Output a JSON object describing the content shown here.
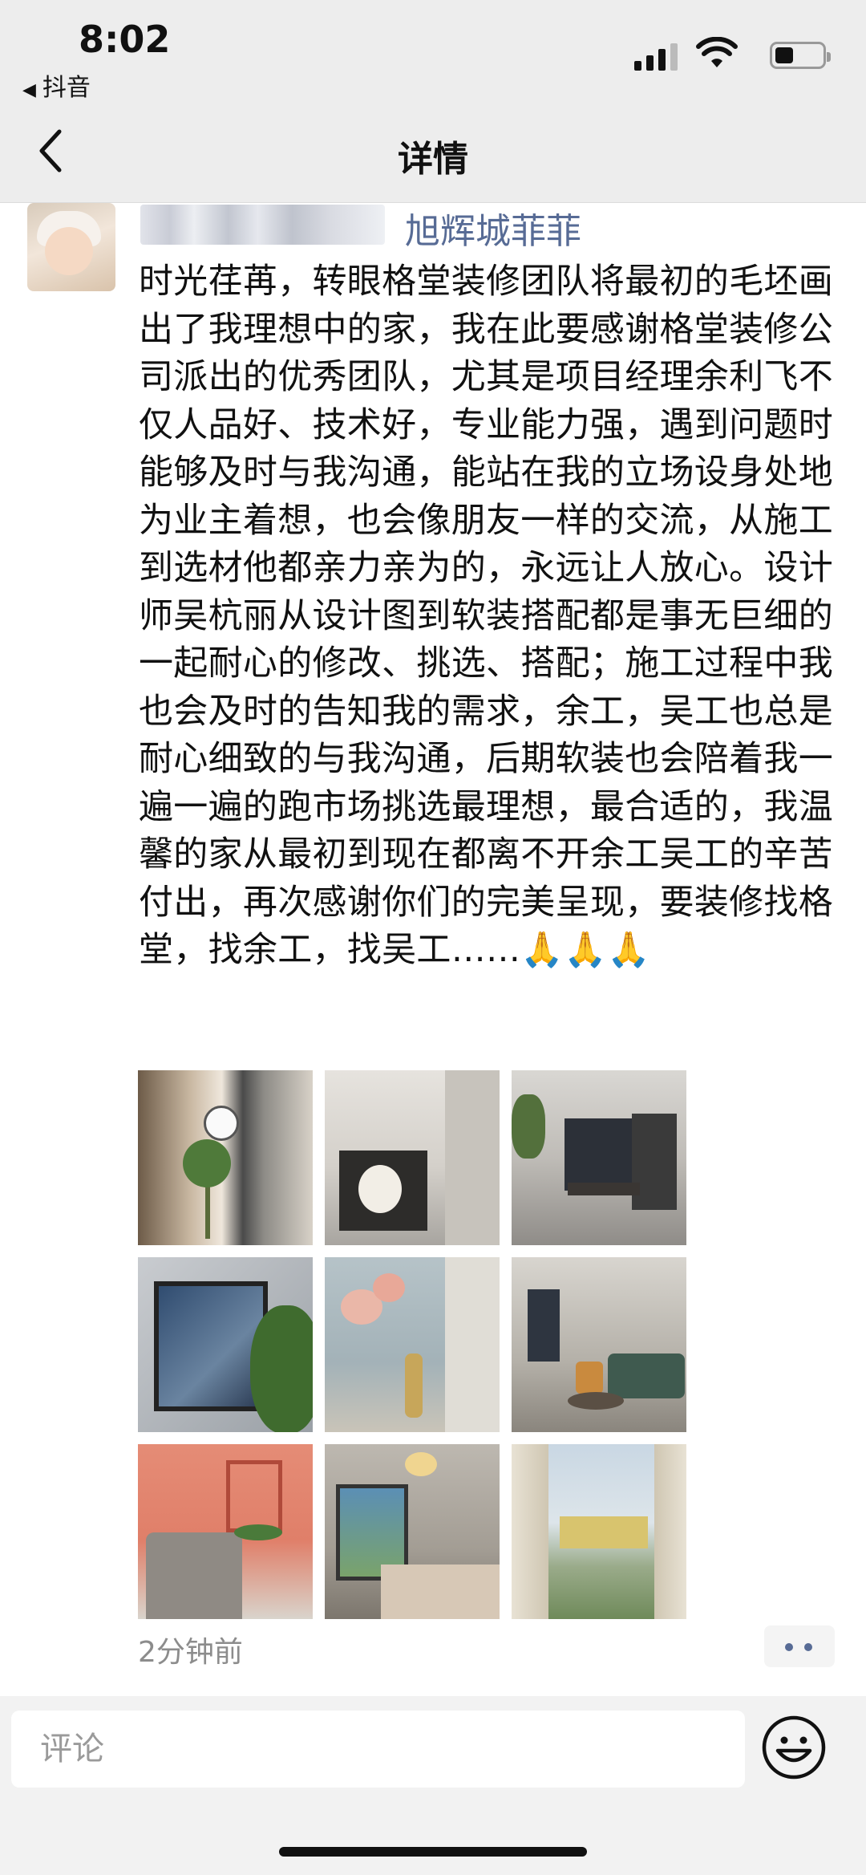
{
  "status_bar": {
    "time": "8:02",
    "back_app": "抖音",
    "back_icon": "triangle-left-icon",
    "signal_icon": "cellular-signal-icon",
    "wifi_icon": "wifi-icon",
    "battery_icon": "battery-icon",
    "battery_level": 0.4
  },
  "nav": {
    "title": "详情",
    "back_icon": "chevron-left-icon"
  },
  "post": {
    "nickname": "旭辉城菲菲",
    "text": "时光荏苒，转眼格堂装修团队将最初的毛坯画出了我理想中的家，我在此要感谢格堂装修公司派出的优秀团队，尤其是项目经理余利飞不仅人品好、技术好，专业能力强，遇到问题时能够及时与我沟通，能站在我的立场设身处地为业主着想，也会像朋友一样的交流，从施工到选材他都亲力亲为的，永远让人放心。设计师吴杭丽从设计图到软装搭配都是事无巨细的一起耐心的修改、挑选、搭配；施工过程中我也会及时的告知我的需求，余工，吴工也总是耐心细致的与我沟通，后期软装也会陪着我一遍一遍的跑市场挑选最理想，最合适的，我温馨的家从最初到现在都离不开余工吴工的辛苦付出，再次感谢你们的完美呈现，要装修找格堂，找余工，找吴工……🙏🙏🙏",
    "photo_count": 9,
    "timestamp": "2分钟前",
    "more_icon": "more-dots-icon"
  },
  "comment_bar": {
    "placeholder": "评论",
    "emoji_icon": "smiley-face-icon"
  },
  "colors": {
    "link": "#576b95",
    "bar_bg": "#ededed",
    "muted": "#8c8c8c"
  }
}
